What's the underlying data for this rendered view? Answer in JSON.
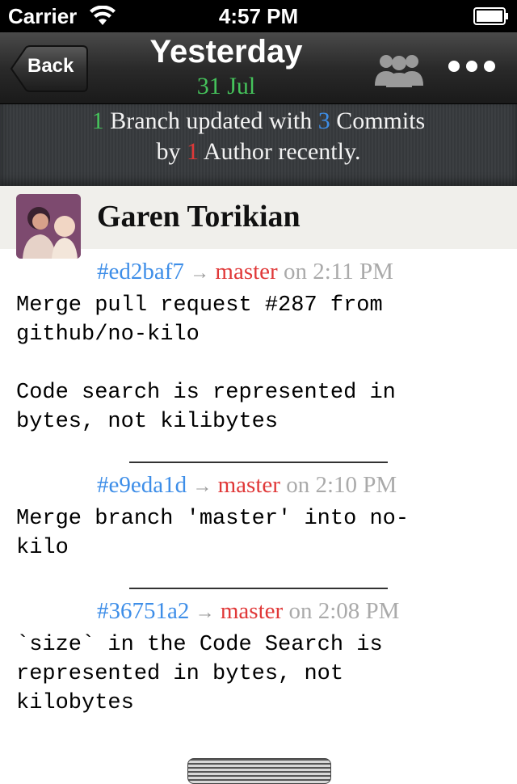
{
  "status_bar": {
    "carrier": "Carrier",
    "time": "4:57 PM"
  },
  "nav": {
    "back_label": "Back",
    "title": "Yesterday",
    "subtitle": "31 Jul"
  },
  "summary": {
    "branch_count": "1",
    "branch_text": " Branch updated with ",
    "commit_count": "3",
    "commit_text": " Commits",
    "by_text": "by ",
    "author_count": "1",
    "author_text": " Author recently."
  },
  "author": {
    "name": "Garen Torikian"
  },
  "commits": [
    {
      "sha": "#ed2baf7",
      "arrow": "→",
      "branch": "master",
      "on": " on 2:11 PM",
      "message": "Merge pull request #287 from\ngithub/no-kilo\n\nCode search is represented in\nbytes, not kilibytes"
    },
    {
      "sha": "#e9eda1d",
      "arrow": "→",
      "branch": "master",
      "on": " on 2:10 PM",
      "message": "Merge branch 'master' into no-\nkilo"
    },
    {
      "sha": "#36751a2",
      "arrow": "→",
      "branch": "master",
      "on": " on 2:08 PM",
      "message": "`size` in the Code Search is\nrepresented in bytes, not\nkilobytes"
    }
  ],
  "colors": {
    "green": "#45c35b",
    "blue": "#3e8ee8",
    "red": "#e03838"
  }
}
